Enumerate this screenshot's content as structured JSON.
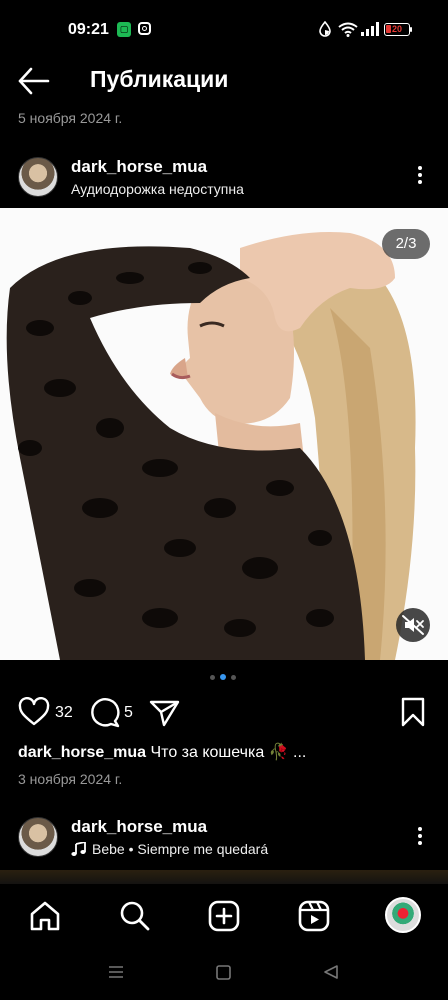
{
  "status_bar": {
    "time": "09:21",
    "battery_level": "20",
    "icons": [
      "chat-notification-icon",
      "instagram-icon",
      "data-saver-icon",
      "wifi-icon",
      "signal-icon",
      "battery-icon"
    ]
  },
  "header": {
    "title": "Публикации",
    "back_icon": "arrow-left-icon"
  },
  "previous_post": {
    "date": "5 ноября 2024 г."
  },
  "post": {
    "username": "dark_horse_mua",
    "audio_text": "Аудиодорожка недоступна",
    "media_counter": "2/3",
    "carousel": {
      "count": 3,
      "active_index": 1
    },
    "likes": "32",
    "comments": "5",
    "caption_username": "dark_horse_mua",
    "caption_text": "Что за кошечка 🥀 ...",
    "date": "3 ноября 2024 г."
  },
  "next_post": {
    "username": "dark_horse_mua",
    "audio_text": "Bebe • Siempre me quedará"
  },
  "bottom_nav": {
    "items": [
      "home-icon",
      "search-icon",
      "create-post-icon",
      "reels-icon",
      "profile-avatar"
    ]
  },
  "system_nav": {
    "items": [
      "recents-icon",
      "home-square-icon",
      "back-triangle-icon"
    ]
  },
  "colors": {
    "background": "#000000",
    "accent_blue": "#3897f0",
    "battery_red": "#e53935",
    "muted_text": "#999999"
  }
}
